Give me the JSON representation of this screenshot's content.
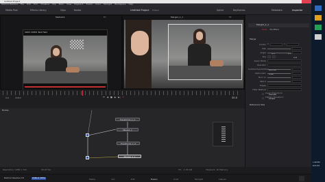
{
  "window": {
    "title": "Untitled Project",
    "project_center": "Untitled Project",
    "edited": "Edited"
  },
  "menu": [
    "DaVinci Resolve",
    "File",
    "Edit",
    "Trim",
    "Timeline",
    "Clip",
    "Mark",
    "View",
    "Playback",
    "Fusion",
    "Color",
    "Fairlight",
    "Workspace",
    "Help"
  ],
  "toolbar": {
    "media_pool": "Media Pool",
    "effects_library": "Effects Library",
    "clips": "Clips",
    "nodes": "Nodes",
    "spline": "Spline",
    "keyframes": "Keyframes",
    "metadata": "Metadata",
    "inspector": "Inspector"
  },
  "viewer_left": {
    "title": "MediaIn1",
    "sub": "SONY CMOS Text Field",
    "zoom": "Fit"
  },
  "viewer_right": {
    "title": "Merge1_1_1",
    "sub": "Merge1_1",
    "zoom": "Fit"
  },
  "timeline": {
    "start": "0.0",
    "in": "118.0",
    "current": "20.0",
    "end": "20.0"
  },
  "inspector": {
    "node_name": "Merge1_1_1",
    "tabs": [
      "Tools",
      "Modifiers"
    ],
    "sections": {
      "merge": "Merge",
      "reference_size": "Reference Size"
    },
    "controls": [
      {
        "label": "Center",
        "x": "0.5",
        "y": "0.5"
      },
      {
        "label": "Size",
        "value": "1.0"
      },
      {
        "label": "Angle",
        "value": "0.0"
      },
      {
        "label": "Flip",
        "value": ""
      },
      {
        "label": "Apply Mode",
        "value": "Normal"
      },
      {
        "label": "Operator",
        "value": "Over"
      },
      {
        "label": "Subtractive/Additive",
        "value": "1.0"
      },
      {
        "label": "Alpha Gain",
        "value": "1.0"
      },
      {
        "label": "Burn In",
        "value": "0.0"
      },
      {
        "label": "Blend",
        "value": "1.0"
      },
      {
        "label": "Edges",
        "value": "Canvas"
      },
      {
        "label": "Filter Method",
        "value": "Linear"
      },
      {
        "label": "Invert Transform",
        "value": ""
      },
      {
        "label": "Flatten Transform",
        "value": ""
      }
    ]
  },
  "nodes_panel": {
    "title": "Nodes",
    "nodes": [
      "Transform1_1_1",
      "Merge1_1",
      "Transform1_1_2",
      "Merge1_1_1"
    ]
  },
  "status": {
    "left": "Resolution: 1280 x 720",
    "fps": "29.97 fps",
    "info": "5% - 1.39 GB",
    "right": "Playback: 16 Memory"
  },
  "pages": [
    "Media",
    "Cut",
    "Edit",
    "Fusion",
    "Color",
    "Fairlight",
    "Deliver"
  ],
  "app_brand": "DaVinci Resolve 16",
  "app_badge": "PUBLIC BETA",
  "clock": {
    "time": "1:48 PM",
    "date": "6/11/19"
  },
  "colors": {
    "accent": "#e0405a",
    "panel": "#232327",
    "highlight": "#c0a050"
  }
}
